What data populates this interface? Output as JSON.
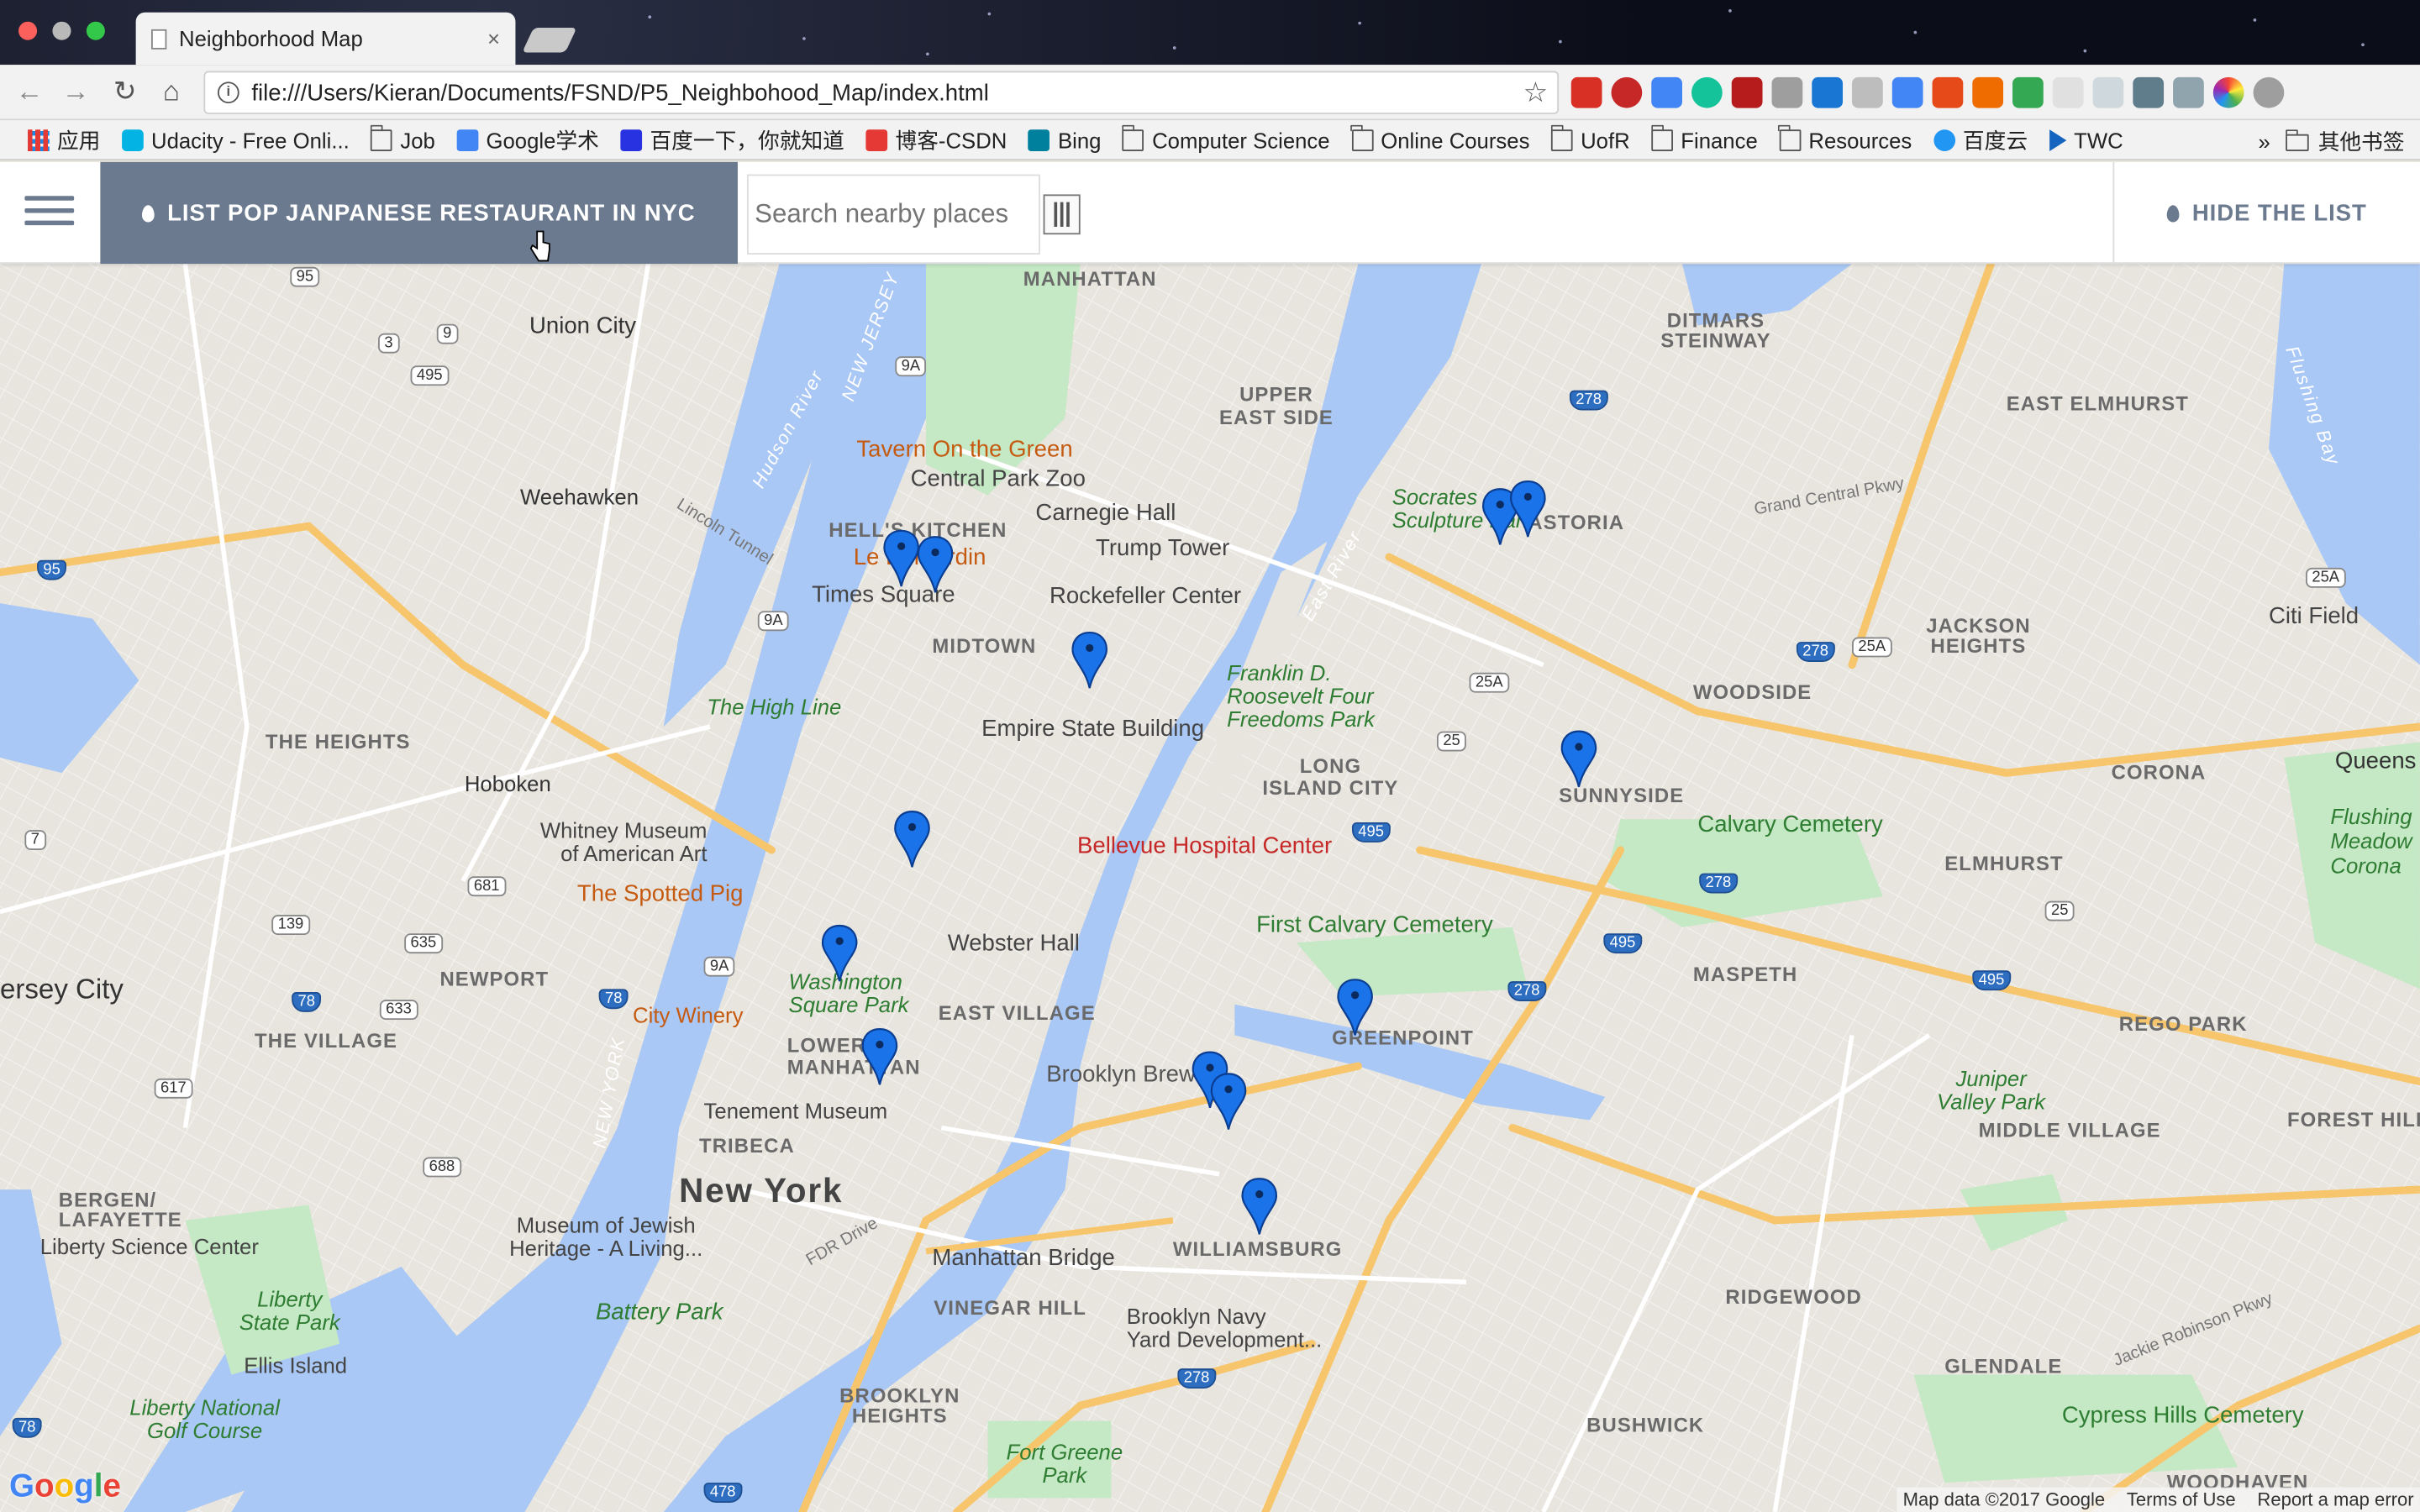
{
  "browser": {
    "tab_title": "Neighborhood Map",
    "tab_close": "×",
    "url": "file:///Users/Kieran/Documents/FSND/P5_Neighbohood_Map/index.html",
    "bookmarks": [
      {
        "label": "应用",
        "icon": "apps-grid-icon"
      },
      {
        "label": "Udacity - Free Onli...",
        "icon": "udacity-icon"
      },
      {
        "label": "Job",
        "icon": "folder-icon"
      },
      {
        "label": "Google学术",
        "icon": "google-scholar-icon"
      },
      {
        "label": "百度一下，你就知道",
        "icon": "baidu-icon"
      },
      {
        "label": "博客-CSDN",
        "icon": "csdn-icon"
      },
      {
        "label": "Bing",
        "icon": "bing-icon"
      },
      {
        "label": "Computer Science",
        "icon": "folder-icon"
      },
      {
        "label": "Online Courses",
        "icon": "folder-icon"
      },
      {
        "label": "UofR",
        "icon": "folder-icon"
      },
      {
        "label": "Finance",
        "icon": "folder-icon"
      },
      {
        "label": "Resources",
        "icon": "folder-icon"
      },
      {
        "label": "百度云",
        "icon": "baidu-cloud-icon"
      },
      {
        "label": "TWC",
        "icon": "twc-icon"
      }
    ],
    "bookmarks_overflow": "»",
    "other_bookmarks": "其他书签"
  },
  "app": {
    "list_button_label": "LIST POP JANPANESE RESTAURANT IN NYC",
    "search_placeholder": "Search nearby places",
    "hide_button_label": "HIDE THE LIST",
    "accent_color": "#6b7a8f"
  },
  "map": {
    "labels": {
      "manhattan": "MANHATTAN",
      "union_city": "Union City",
      "weehawken": "Weehawken",
      "hoboken": "Hoboken",
      "the_heights": "THE HEIGHTS",
      "jersey_city": "ersey City",
      "newport": "NEWPORT",
      "the_village": "THE VILLAGE",
      "bergen": "BERGEN/\nLAFAYETTE",
      "upper_east_side": "UPPER\nEAST SIDE",
      "hells_kitchen": "HELL'S KITCHEN",
      "midtown": "MIDTOWN",
      "east_village": "EAST VILLAGE",
      "lower_manhattan": "LOWER\nMANHATTAN",
      "tribeca": "TRIBECA",
      "new_york": "New York",
      "vinegar_hill": "VINEGAR HILL",
      "brooklyn_heights": "BROOKLYN\nHEIGHTS",
      "long_island_city": "LONG\nISLAND CITY",
      "sunnyside": "SUNNYSIDE",
      "woodside": "WOODSIDE",
      "astoria": "ASTORIA",
      "ditmars": "DITMARS\nSTEINWAY",
      "east_elmhurst": "EAST ELMHURST",
      "jackson_heights": "JACKSON\nHEIGHTS",
      "corona": "CORONA",
      "elmhurst": "ELMHURST",
      "maspeth": "MASPETH",
      "rego_park": "REGO PARK",
      "forest_hills": "FOREST HILLS",
      "middle_village": "MIDDLE VILLAGE",
      "greenpoint": "GREENPOINT",
      "williamsburg": "WILLIAMSBURG",
      "ridgewood": "RIDGEWOOD",
      "glendale": "GLENDALE",
      "bushwick": "BUSHWICK",
      "woodhaven": "WOODHAVEN",
      "queens": "Queens",
      "citi_field": "Citi Field",
      "flushing_meadows": "Flushing\nMeadow\nCorona",
      "tavern": "Tavern On the Green",
      "central_park_zoo": "Central Park Zoo",
      "carnegie_hall": "Carnegie Hall",
      "trump_tower": "Trump Tower",
      "le_bernardin": "Le Bernardin",
      "times_square": "Times Square",
      "rockefeller": "Rockefeller Center",
      "empire_state": "Empire State Building",
      "high_line": "The High Line",
      "whitney": "Whitney Museum\nof American Art",
      "spotted_pig": "The Spotted Pig",
      "webster_hall": "Webster Hall",
      "washington_sq": "Washington\nSquare Park",
      "city_winery": "City Winery",
      "tenement": "Tenement Museum",
      "jewish_heritage": "Museum of Jewish\nHeritage - A Living...",
      "battery_park": "Battery Park",
      "liberty_science": "Liberty Science Center",
      "liberty_state": "Liberty\nState Park",
      "ellis_island": "Ellis Island",
      "liberty_national": "Liberty National\nGolf Course",
      "bellevue": "Bellevue Hospital Center",
      "fdr_park": "Franklin D.\nRoosevelt Four\nFreedoms Park",
      "socrates": "Socrates\nSculpture Park",
      "calvary": "Calvary Cemetery",
      "first_calvary": "First Calvary Cemetery",
      "brooklyn_brew": "Brooklyn Brew",
      "manhattan_bridge": "Manhattan Bridge",
      "navy_yard": "Brooklyn Navy\nYard Development...",
      "fort_greene": "Fort Greene\nPark",
      "juniper": "Juniper\nValley Park",
      "cypress_hills": "Cypress Hills Cemetery",
      "hudson_river": "Hudson River",
      "east_river": "East River",
      "lincoln_tunnel": "Lincoln Tunnel",
      "grand_central": "Grand Central Pkwy",
      "fdr_drive": "FDR Drive",
      "jackie_robinson": "Jackie Robinson Pkwy",
      "flushing_bay": "Flushing Bay",
      "new_jersey": "NEW JERSEY",
      "new_york_state": "NEW YORK"
    },
    "footer": {
      "data": "Map data ©2017 Google",
      "terms": "Terms of Use",
      "report": "Report a map error"
    },
    "google_logo": "Google",
    "marker_color": "#1a73e8",
    "marker_count": 13
  }
}
